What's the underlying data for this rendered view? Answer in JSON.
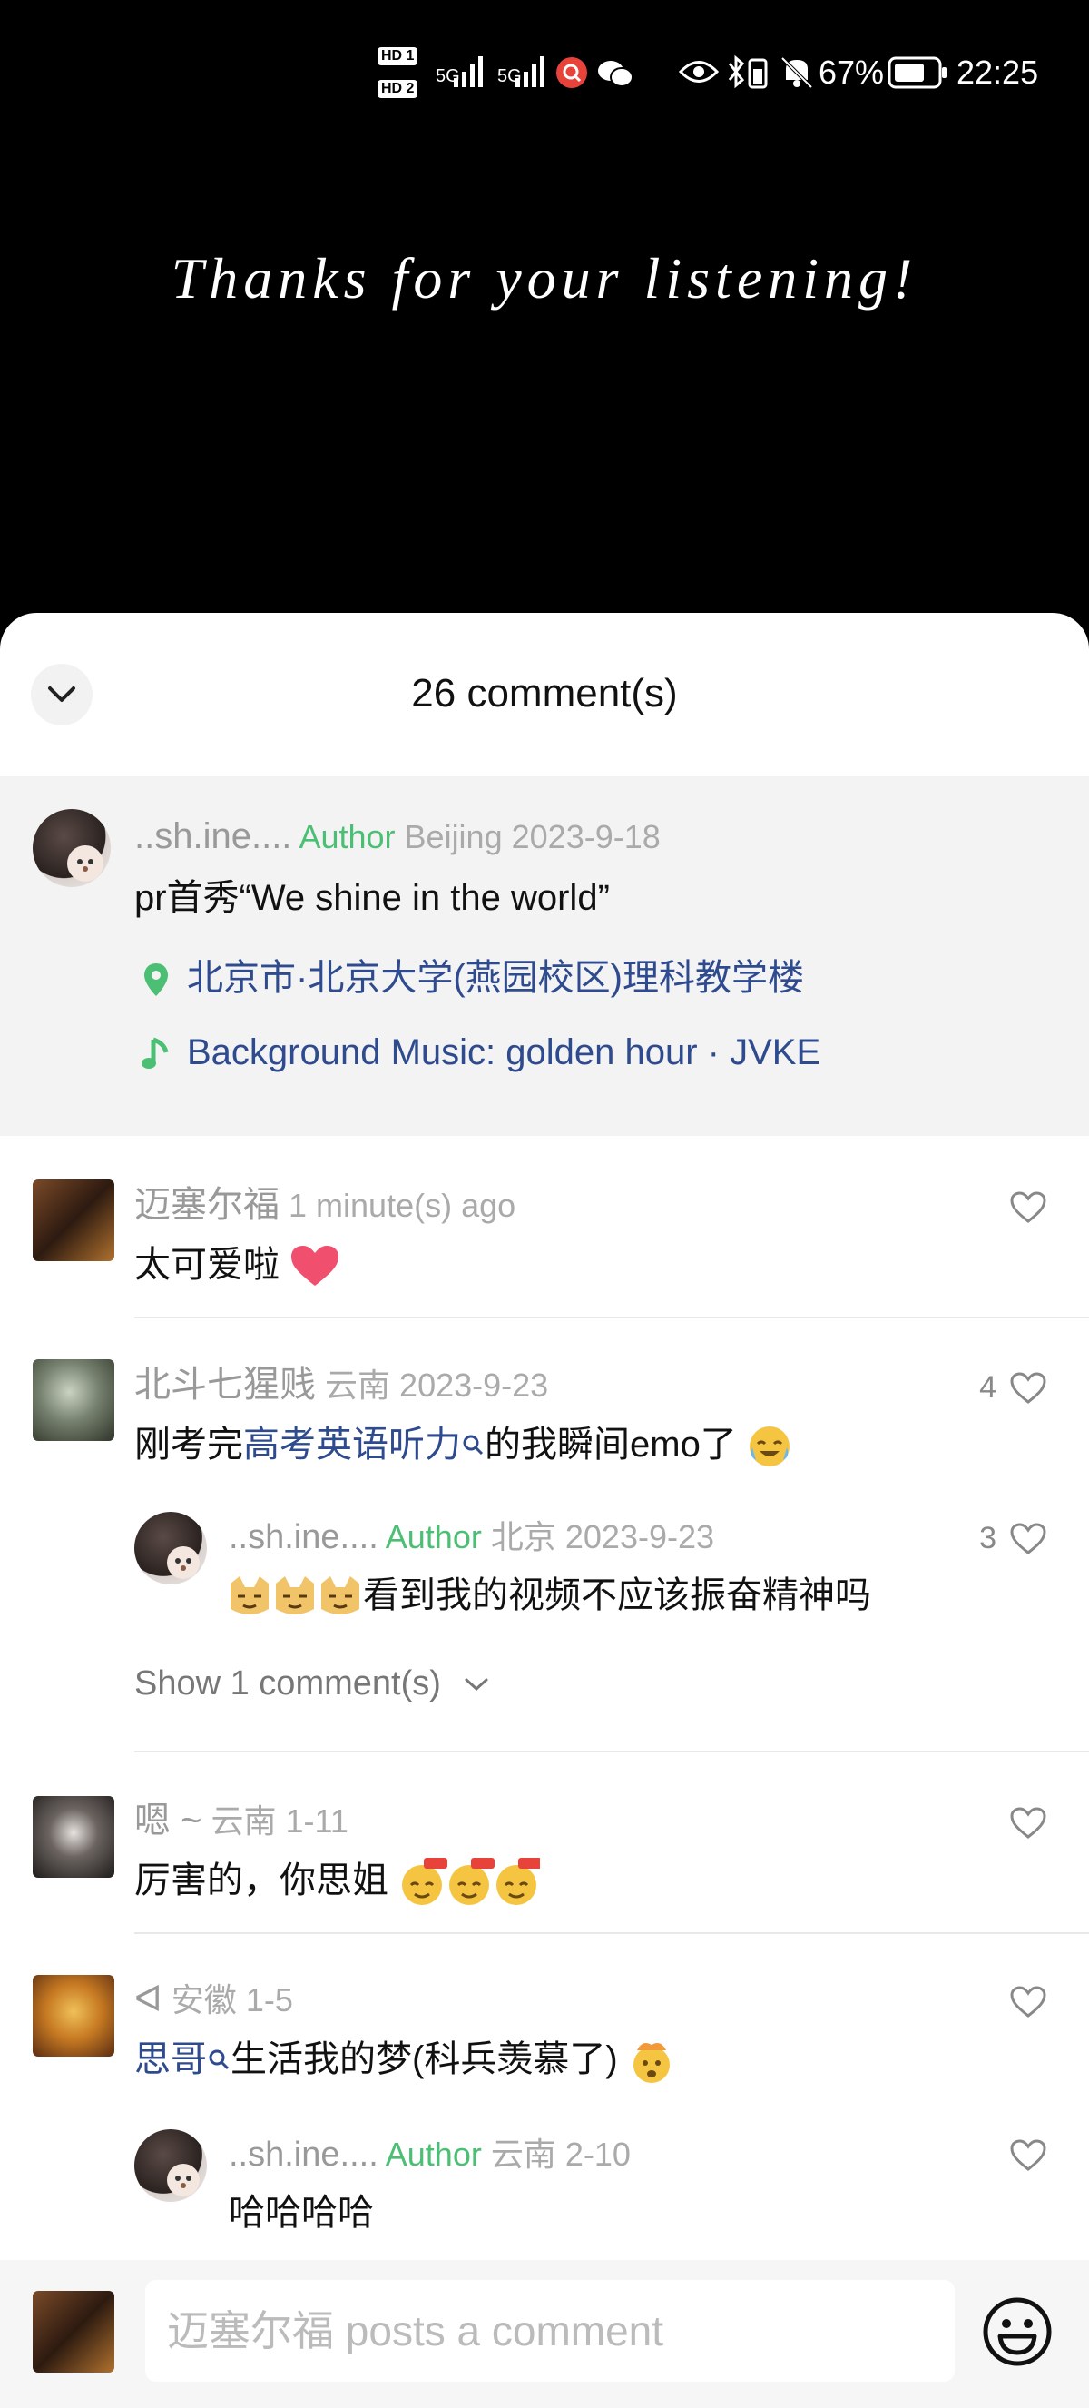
{
  "status_bar": {
    "hd1": "HD 1",
    "hd2": "HD 2",
    "signal1": "5G",
    "signal2": "5G",
    "battery_percent": "67%",
    "time": "22:25"
  },
  "video": {
    "title": "Thanks for your listening!"
  },
  "sheet": {
    "comment_count_label": "26 comment(s)",
    "post": {
      "username": "..sh.ine....",
      "author_tag": "Author",
      "location": "Beijing",
      "date": "2023-9-18",
      "text": "pr首秀“We shine in the world”",
      "place": "北京市·北京大学(燕园校区)理科教学楼",
      "music": "Background Music: golden hour · JVKE"
    },
    "comments": [
      {
        "username": "迈塞尔福",
        "location": "",
        "date": "1 minute(s) ago",
        "text": "太可爱啦",
        "likes": ""
      },
      {
        "username": "北斗七猩贱",
        "location": "云南",
        "date": "2023-9-23",
        "text_prefix": "刚考完",
        "link": "高考英语听力",
        "text_suffix": "的我瞬间emo了",
        "likes": "4",
        "reply": {
          "username": "..sh.ine....",
          "author_tag": "Author",
          "location": "北京",
          "date": "2023-9-23",
          "text": "看到我的视频不应该振奋精神吗",
          "likes": "3"
        },
        "show_more": "Show 1 comment(s)"
      },
      {
        "username": "嗯 ~",
        "location": "云南",
        "date": "1-11",
        "text": "厉害的，你思姐",
        "likes": ""
      },
      {
        "username": "ᐊ",
        "location": "安徽",
        "date": "1-5",
        "link": "思哥",
        "text_suffix": "生活我的梦(科兵羡慕了)",
        "likes": "",
        "reply": {
          "username": "..sh.ine....",
          "author_tag": "Author",
          "location": "云南",
          "date": "2-10",
          "text": "哈哈哈哈",
          "likes": ""
        }
      }
    ],
    "input_placeholder": "迈塞尔福 posts a comment"
  },
  "colors": {
    "author_green": "#4bbf73",
    "link_blue": "#2f4b8f",
    "heart_red": "#f0506e"
  }
}
